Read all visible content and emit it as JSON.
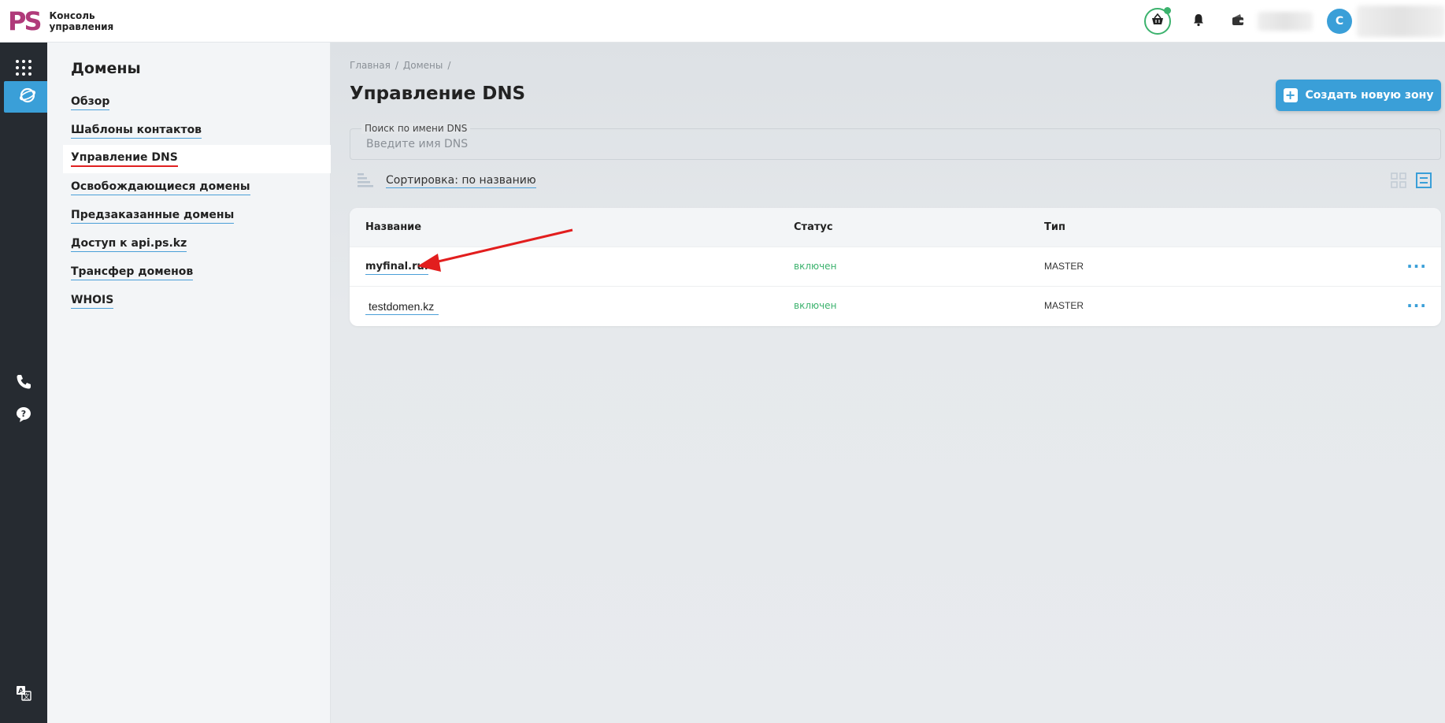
{
  "header": {
    "logo_mark": "PS",
    "logo_line1": "Консоль",
    "logo_line2": "управления",
    "avatar_letter": "С"
  },
  "sidebar": {
    "title": "Домены",
    "items": [
      {
        "label": "Обзор"
      },
      {
        "label": "Шаблоны контактов"
      },
      {
        "label": "Управление DNS"
      },
      {
        "label": "Освобождающиеся домены"
      },
      {
        "label": "Предзаказанные домены"
      },
      {
        "label": "Доступ к api.ps.kz"
      },
      {
        "label": "Трансфер доменов"
      },
      {
        "label": "WHOIS"
      }
    ],
    "active_index": 2
  },
  "breadcrumbs": [
    "Главная",
    "Домены"
  ],
  "page": {
    "title": "Управление DNS",
    "create_button": "Создать новую зону"
  },
  "search": {
    "label": "Поиск по имени DNS",
    "placeholder": "Введите имя DNS",
    "value": ""
  },
  "sort": {
    "label": "Сортировка: по названию"
  },
  "table": {
    "columns": [
      "Название",
      "Статус",
      "Тип"
    ],
    "rows": [
      {
        "name": "myfinal.ru.",
        "status": "включен",
        "type": "MASTER"
      },
      {
        "name": "testdomen.kz",
        "status": "включен",
        "type": "MASTER"
      }
    ]
  },
  "colors": {
    "accent": "#3a9fd8",
    "rail": "#262b31",
    "status_ok": "#3bb26d",
    "active_underline": "#e02020",
    "logo": "#b03a7a"
  }
}
